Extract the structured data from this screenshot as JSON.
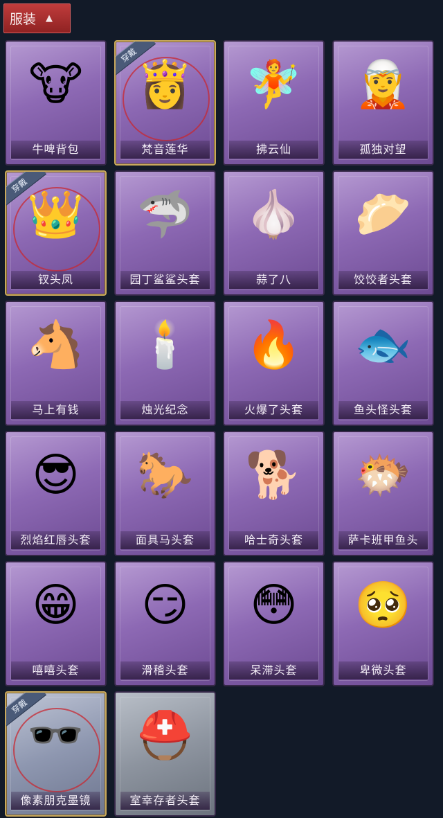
{
  "header": {
    "title": "服装",
    "chevron": "chevron-up-icon"
  },
  "badge_label": "穿戴",
  "items": [
    {
      "name": "牛啤背包",
      "equipped": false,
      "frame": "purple",
      "icon": "cow-beer-barrel-icon",
      "glyph": "🐮"
    },
    {
      "name": "梵音莲华",
      "equipped": true,
      "frame": "purple",
      "icon": "lotus-girl-icon",
      "glyph": "👸"
    },
    {
      "name": "拂云仙",
      "equipped": false,
      "frame": "purple",
      "icon": "cloud-immortal-charm-icon",
      "glyph": "🧚"
    },
    {
      "name": "孤独对望",
      "equipped": false,
      "frame": "purple",
      "icon": "lonely-gaze-charm-icon",
      "glyph": "🧝"
    },
    {
      "name": "钗头凤",
      "equipped": true,
      "frame": "purple",
      "icon": "phoenix-crown-girl-icon",
      "glyph": "👑"
    },
    {
      "name": "园丁鲨鲨头套",
      "equipped": false,
      "frame": "purple",
      "icon": "gardener-shark-icon",
      "glyph": "🦈"
    },
    {
      "name": "蒜了八",
      "equipped": false,
      "frame": "purple",
      "icon": "garlic-icon",
      "glyph": "🧄"
    },
    {
      "name": "饺饺者头套",
      "equipped": false,
      "frame": "purple",
      "icon": "dumpling-head-icon",
      "glyph": "🥟"
    },
    {
      "name": "马上有钱",
      "equipped": false,
      "frame": "purple",
      "icon": "red-horse-icon",
      "glyph": "🐴"
    },
    {
      "name": "烛光纪念",
      "equipped": false,
      "frame": "purple",
      "icon": "candle-icon",
      "glyph": "🕯️"
    },
    {
      "name": "火爆了头套",
      "equipped": false,
      "frame": "purple",
      "icon": "fireball-head-icon",
      "glyph": "🔥"
    },
    {
      "name": "鱼头怪头套",
      "equipped": false,
      "frame": "purple",
      "icon": "fish-head-mask-icon",
      "glyph": "🐟"
    },
    {
      "name": "烈焰红唇头套",
      "equipped": false,
      "frame": "purple",
      "icon": "yellow-rodent-mask-icon",
      "glyph": "😎"
    },
    {
      "name": "面具马头套",
      "equipped": false,
      "frame": "purple",
      "icon": "horse-mask-icon",
      "glyph": "🐎"
    },
    {
      "name": "哈士奇头套",
      "equipped": false,
      "frame": "purple",
      "icon": "husky-mask-icon",
      "glyph": "🐕"
    },
    {
      "name": "萨卡班甲鱼头",
      "equipped": false,
      "frame": "purple",
      "icon": "sacabambaspis-icon",
      "glyph": "🐡"
    },
    {
      "name": "嘻嘻头套",
      "equipped": false,
      "frame": "purple",
      "icon": "grin-emoji-head-icon",
      "glyph": "😁"
    },
    {
      "name": "滑稽头套",
      "equipped": false,
      "frame": "purple",
      "icon": "funny-emoji-head-icon",
      "glyph": "😏"
    },
    {
      "name": "呆滞头套",
      "equipped": false,
      "frame": "purple",
      "icon": "blank-stare-emoji-head-icon",
      "glyph": "😳"
    },
    {
      "name": "卑微头套",
      "equipped": false,
      "frame": "purple",
      "icon": "humble-emoji-head-icon",
      "glyph": "🥺"
    },
    {
      "name": "像素朋克墨镜",
      "equipped": true,
      "frame": "blue",
      "icon": "pixel-sunglasses-icon",
      "glyph": "🕶️"
    },
    {
      "name": "室幸存者头套",
      "equipped": false,
      "frame": "grey",
      "icon": "gas-mask-helmet-icon",
      "glyph": "⛑️"
    }
  ]
}
